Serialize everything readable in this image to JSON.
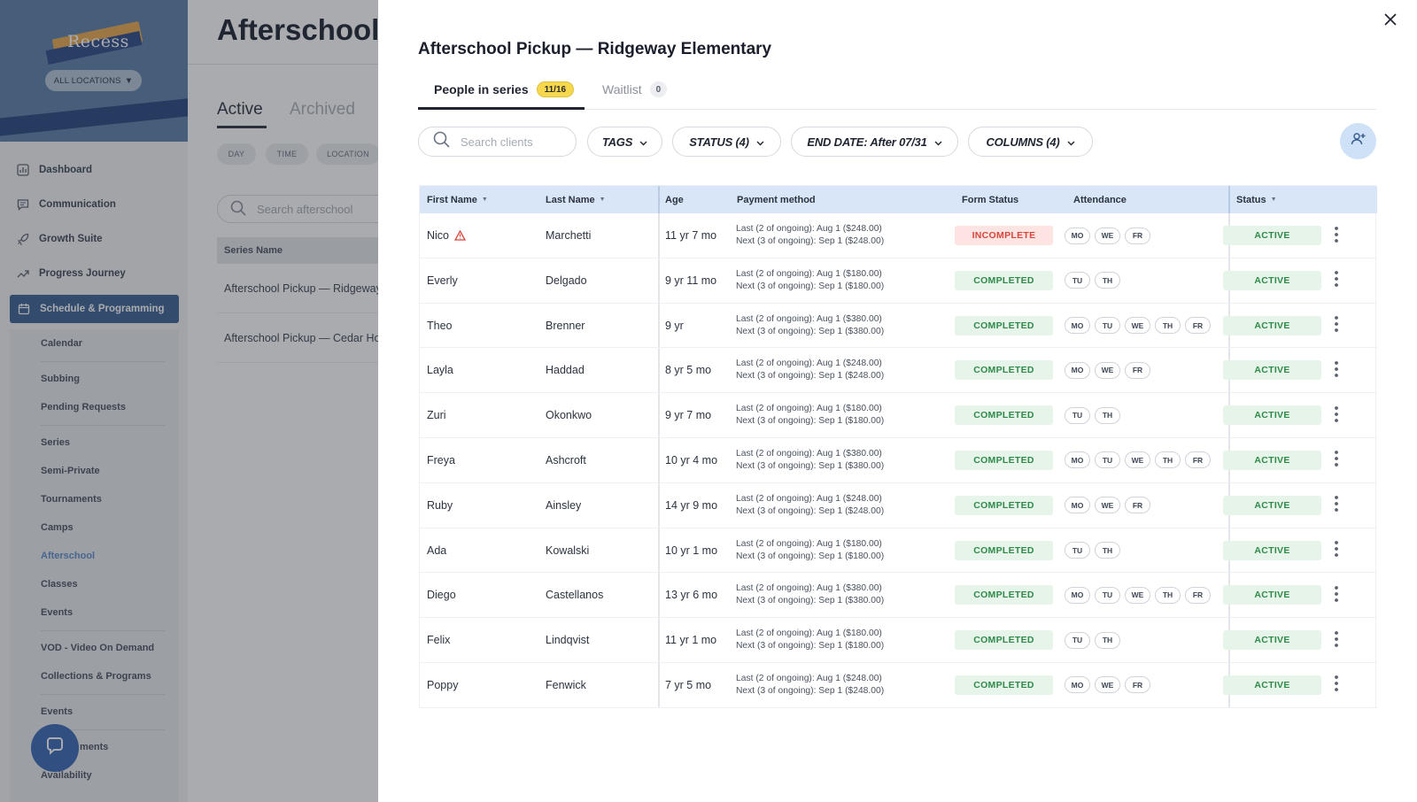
{
  "app": {
    "brand": "Recess",
    "location_filter": "ALL LOCATIONS",
    "colors": {
      "accent": "#3b5f91",
      "header_blue": "#d8e6f7",
      "success": "#2f8a4a",
      "danger": "#d9463b",
      "highlight": "#f6d84e"
    }
  },
  "sidebar": {
    "nav": [
      {
        "label": "Dashboard",
        "icon": "bar-chart-icon"
      },
      {
        "label": "Communication",
        "icon": "chat-icon"
      },
      {
        "label": "Growth Suite",
        "icon": "rocket-icon"
      },
      {
        "label": "Progress Journey",
        "icon": "trend-icon"
      },
      {
        "label": "Schedule & Programming",
        "icon": "calendar-icon"
      }
    ],
    "submenu": [
      "Calendar",
      "Subbing",
      "Pending Requests",
      "Series",
      "Semi-Private",
      "Tournaments",
      "Camps",
      "Afterschool",
      "Classes",
      "Events",
      "VOD - Video On Demand",
      "Collections & Programs",
      "Events",
      "ments",
      "Availability"
    ]
  },
  "background": {
    "title": "Afterschool",
    "tabs": [
      "Active",
      "Archived"
    ],
    "chips": [
      "DAY",
      "TIME",
      "LOCATION"
    ],
    "search_placeholder": "Search afterschool",
    "table_header": "Series Name",
    "rows": [
      "Afterschool Pickup — Ridgeway",
      "Afterschool Pickup — Cedar Ho"
    ]
  },
  "drawer": {
    "title": "Afterschool Pickup — Ridgeway Elementary",
    "tabs": [
      {
        "label": "People in series",
        "badge": "11/16"
      },
      {
        "label": "Waitlist",
        "badge": "0"
      }
    ],
    "search_placeholder": "Search clients",
    "filters": [
      "TAGS",
      "STATUS  (4)",
      "END DATE: After 07/31",
      "COLUMNS  (4)"
    ],
    "columns": [
      "First Name",
      "Last Name",
      "Age",
      "Payment method",
      "Form Status",
      "Attendance",
      "Status"
    ],
    "rows": [
      {
        "first": "Nico",
        "warn": true,
        "last": "Marchetti",
        "age": "11 yr 7 mo",
        "pay_last": "Last (2 of ongoing): Aug 1 ($248.00)",
        "pay_next": "Next (3 of ongoing): Sep 1 ($248.00)",
        "form": "INCOMPLETE",
        "days": [
          "MO",
          "WE",
          "FR"
        ],
        "status": "ACTIVE"
      },
      {
        "first": "Everly",
        "warn": false,
        "last": "Delgado",
        "age": "9 yr 11 mo",
        "pay_last": "Last (2 of ongoing): Aug 1 ($180.00)",
        "pay_next": "Next (3 of ongoing): Sep 1 ($180.00)",
        "form": "COMPLETED",
        "days": [
          "TU",
          "TH"
        ],
        "status": "ACTIVE"
      },
      {
        "first": "Theo",
        "warn": false,
        "last": "Brenner",
        "age": "9 yr",
        "pay_last": "Last (2 of ongoing): Aug 1 ($380.00)",
        "pay_next": "Next (3 of ongoing): Sep 1 ($380.00)",
        "form": "COMPLETED",
        "days": [
          "MO",
          "TU",
          "WE",
          "TH",
          "FR"
        ],
        "status": "ACTIVE"
      },
      {
        "first": "Layla",
        "warn": false,
        "last": "Haddad",
        "age": "8 yr 5 mo",
        "pay_last": "Last (2 of ongoing): Aug 1 ($248.00)",
        "pay_next": "Next (3 of ongoing): Sep 1 ($248.00)",
        "form": "COMPLETED",
        "days": [
          "MO",
          "WE",
          "FR"
        ],
        "status": "ACTIVE"
      },
      {
        "first": "Zuri",
        "warn": false,
        "last": "Okonkwo",
        "age": "9 yr 7 mo",
        "pay_last": "Last (2 of ongoing): Aug 1 ($180.00)",
        "pay_next": "Next (3 of ongoing): Sep 1 ($180.00)",
        "form": "COMPLETED",
        "days": [
          "TU",
          "TH"
        ],
        "status": "ACTIVE"
      },
      {
        "first": "Freya",
        "warn": false,
        "last": "Ashcroft",
        "age": "10 yr 4 mo",
        "pay_last": "Last (2 of ongoing): Aug 1 ($380.00)",
        "pay_next": "Next (3 of ongoing): Sep 1 ($380.00)",
        "form": "COMPLETED",
        "days": [
          "MO",
          "TU",
          "WE",
          "TH",
          "FR"
        ],
        "status": "ACTIVE"
      },
      {
        "first": "Ruby",
        "warn": false,
        "last": "Ainsley",
        "age": "14 yr 9 mo",
        "pay_last": "Last (2 of ongoing): Aug 1 ($248.00)",
        "pay_next": "Next (3 of ongoing): Sep 1 ($248.00)",
        "form": "COMPLETED",
        "days": [
          "MO",
          "WE",
          "FR"
        ],
        "status": "ACTIVE"
      },
      {
        "first": "Ada",
        "warn": false,
        "last": "Kowalski",
        "age": "10 yr 1 mo",
        "pay_last": "Last (2 of ongoing): Aug 1 ($180.00)",
        "pay_next": "Next (3 of ongoing): Sep 1 ($180.00)",
        "form": "COMPLETED",
        "days": [
          "TU",
          "TH"
        ],
        "status": "ACTIVE"
      },
      {
        "first": "Diego",
        "warn": false,
        "last": "Castellanos",
        "age": "13 yr 6 mo",
        "pay_last": "Last (2 of ongoing): Aug 1 ($380.00)",
        "pay_next": "Next (3 of ongoing): Sep 1 ($380.00)",
        "form": "COMPLETED",
        "days": [
          "MO",
          "TU",
          "WE",
          "TH",
          "FR"
        ],
        "status": "ACTIVE"
      },
      {
        "first": "Felix",
        "warn": false,
        "last": "Lindqvist",
        "age": "11 yr 1 mo",
        "pay_last": "Last (2 of ongoing): Aug 1 ($180.00)",
        "pay_next": "Next (3 of ongoing): Sep 1 ($180.00)",
        "form": "COMPLETED",
        "days": [
          "TU",
          "TH"
        ],
        "status": "ACTIVE"
      },
      {
        "first": "Poppy",
        "warn": false,
        "last": "Fenwick",
        "age": "7 yr 5 mo",
        "pay_last": "Last (2 of ongoing): Aug 1 ($248.00)",
        "pay_next": "Next (3 of ongoing): Sep 1 ($248.00)",
        "form": "COMPLETED",
        "days": [
          "MO",
          "WE",
          "FR"
        ],
        "status": "ACTIVE"
      }
    ]
  }
}
